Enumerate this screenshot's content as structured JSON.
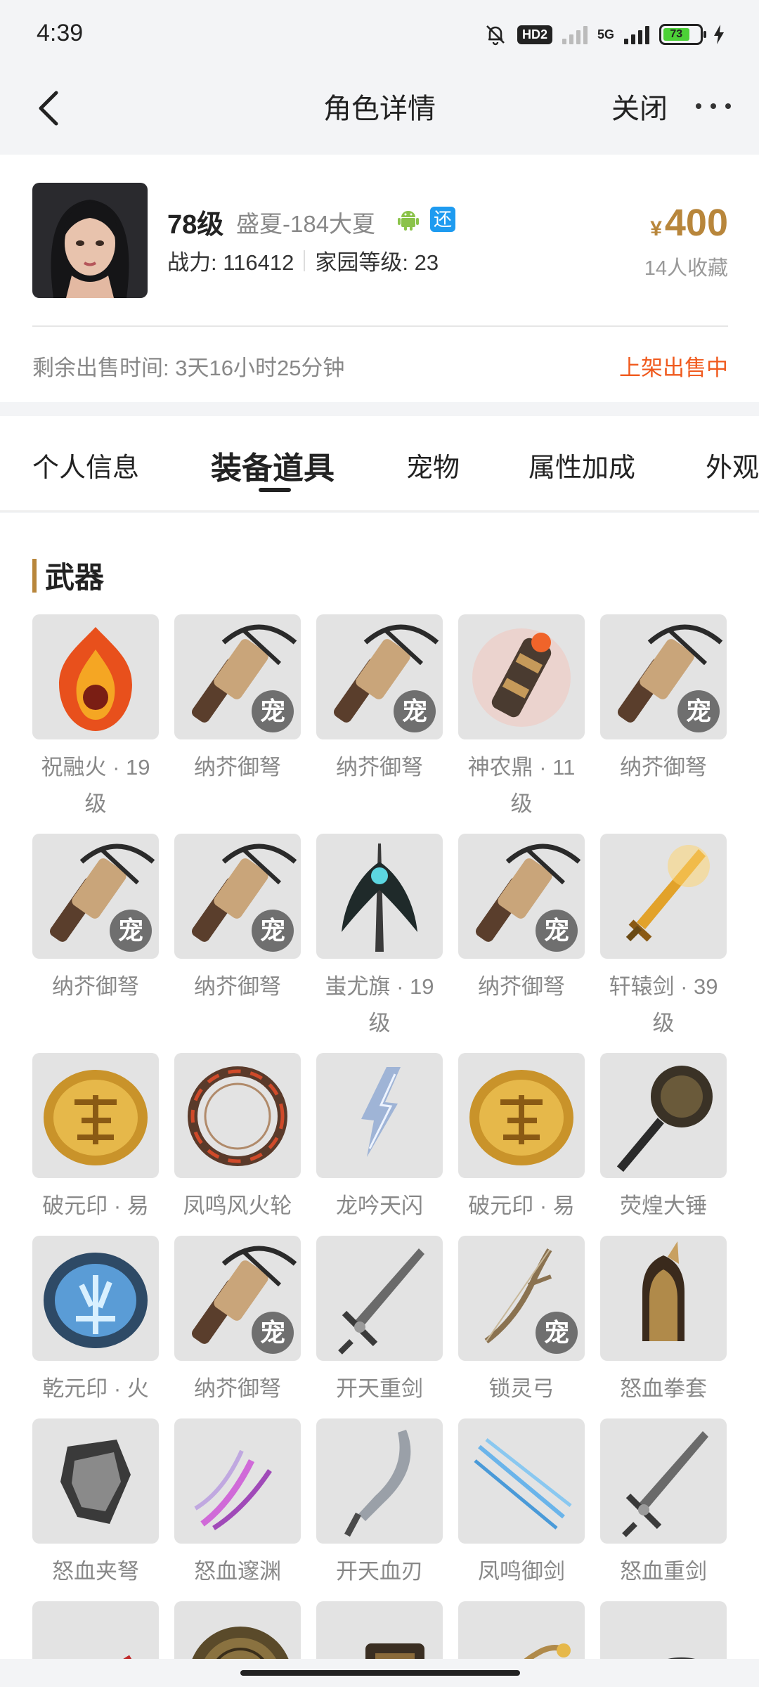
{
  "status_bar": {
    "time": "4:39",
    "hd_label": "HD2",
    "net_label": "5G",
    "battery": "73"
  },
  "nav": {
    "title": "角色详情",
    "close_label": "关闭"
  },
  "role": {
    "level": "78级",
    "server": "盛夏-184大夏",
    "return_badge": "还",
    "power": "战力: 116412",
    "home_level": "家园等级: 23",
    "price_symbol": "¥",
    "price": "400",
    "favorites": "14人收藏",
    "remaining_time": "剩余出售时间: 3天16小时25分钟",
    "sale_status": "上架出售中"
  },
  "tabs": [
    "个人信息",
    "装备道具",
    "宠物",
    "属性加成",
    "外观"
  ],
  "active_tab": "装备道具",
  "section": {
    "title": "武器",
    "pet_badge": "宠",
    "items": [
      {
        "name": "祝融火 · 19级",
        "icon": "flame-emblem-icon",
        "pet": false
      },
      {
        "name": "纳芥御弩",
        "icon": "crossbow-icon",
        "pet": true
      },
      {
        "name": "纳芥御弩",
        "icon": "crossbow-icon",
        "pet": true
      },
      {
        "name": "神农鼎 · 11级",
        "icon": "glowing-cauldron-icon",
        "pet": false
      },
      {
        "name": "纳芥御弩",
        "icon": "crossbow-icon",
        "pet": true
      },
      {
        "name": "纳芥御弩",
        "icon": "crossbow-icon",
        "pet": true
      },
      {
        "name": "纳芥御弩",
        "icon": "crossbow-icon",
        "pet": true
      },
      {
        "name": "蚩尤旗 · 19级",
        "icon": "war-banner-icon",
        "pet": false
      },
      {
        "name": "纳芥御弩",
        "icon": "crossbow-icon",
        "pet": true
      },
      {
        "name": "轩辕剑 · 39级",
        "icon": "golden-sword-icon",
        "pet": false
      },
      {
        "name": "破元印 · 易",
        "icon": "golden-seal-icon",
        "pet": false
      },
      {
        "name": "凤鸣风火轮",
        "icon": "fire-wheel-icon",
        "pet": false
      },
      {
        "name": "龙吟天闪",
        "icon": "lightning-blade-icon",
        "pet": false
      },
      {
        "name": "破元印 · 易",
        "icon": "golden-seal-icon",
        "pet": false
      },
      {
        "name": "荧煌大锤",
        "icon": "war-hammer-icon",
        "pet": false
      },
      {
        "name": "乾元印 · 火",
        "icon": "blue-seal-icon",
        "pet": false
      },
      {
        "name": "纳芥御弩",
        "icon": "crossbow-icon",
        "pet": true
      },
      {
        "name": "开天重剑",
        "icon": "heavy-sword-icon",
        "pet": false
      },
      {
        "name": "锁灵弓",
        "icon": "bow-icon",
        "pet": true
      },
      {
        "name": "怒血拳套",
        "icon": "gauntlet-icon",
        "pet": false
      },
      {
        "name": "怒血夹弩",
        "icon": "claw-crossbow-icon",
        "pet": false
      },
      {
        "name": "怒血邃渊",
        "icon": "purple-claw-icon",
        "pet": false
      },
      {
        "name": "开天血刃",
        "icon": "curved-blade-icon",
        "pet": false
      },
      {
        "name": "凤鸣御剑",
        "icon": "flying-swords-icon",
        "pet": false
      },
      {
        "name": "怒血重剑",
        "icon": "heavy-sword-icon",
        "pet": false
      },
      {
        "name": "",
        "icon": "red-claw-icon",
        "pet": false
      },
      {
        "name": "",
        "icon": "bronze-shield-icon",
        "pet": false
      },
      {
        "name": "",
        "icon": "mechanism-icon",
        "pet": false
      },
      {
        "name": "",
        "icon": "golden-bow-icon",
        "pet": false
      },
      {
        "name": "",
        "icon": "steel-crossbow-icon",
        "pet": false
      }
    ]
  },
  "colors": {
    "accent_gold": "#b8863b",
    "sale_orange": "#f05a1e",
    "badge_blue": "#1e9bf0",
    "android_green": "#8bc34a"
  }
}
